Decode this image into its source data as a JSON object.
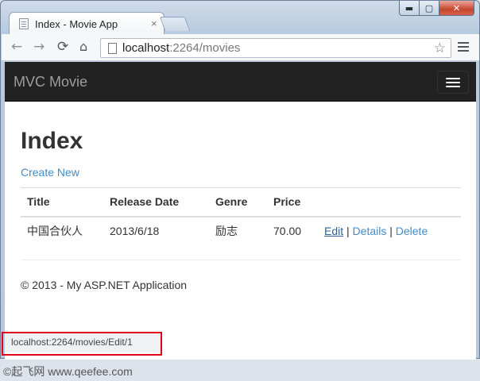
{
  "browser": {
    "tab_title": "Index - Movie App",
    "tab_close": "×",
    "window_controls": {
      "minimize": "▬",
      "maximize": "▢",
      "close": "✕"
    },
    "nav": {
      "back": "←",
      "forward": "→",
      "reload": "⟳",
      "home": "⌂"
    },
    "url_host": "localhost",
    "url_rest": ":2264/movies",
    "bookmark_icon": "☆",
    "status_url": "localhost:2264/movies/Edit/1"
  },
  "site": {
    "brand": "MVC Movie",
    "page_title": "Index",
    "create_link": "Create New",
    "footer": "© 2013 - My ASP.NET Application"
  },
  "table": {
    "headers": [
      "Title",
      "Release Date",
      "Genre",
      "Price"
    ],
    "rows": [
      {
        "title": "中国合伙人",
        "release_date": "2013/6/18",
        "genre": "励志",
        "price": "70.00",
        "actions": {
          "edit": "Edit",
          "details": "Details",
          "delete": "Delete",
          "separator": "|"
        }
      }
    ]
  },
  "watermark": "©起飞网 www.qeefee.com",
  "colors": {
    "navbar": "#222222",
    "link": "#428bca",
    "highlight_box": "#e0001b"
  },
  "icons": [
    "page-icon",
    "back-icon",
    "forward-icon",
    "reload-icon",
    "home-icon",
    "star-icon",
    "menu-icon",
    "hamburger-icon"
  ]
}
